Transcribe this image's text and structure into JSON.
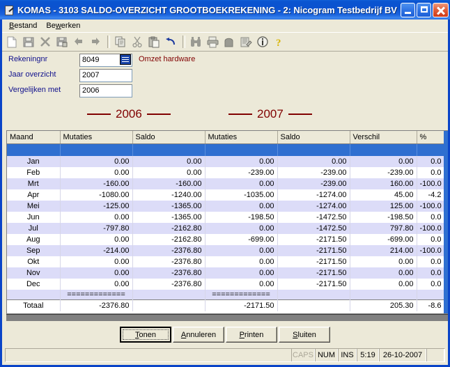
{
  "window": {
    "title": "KOMAS - 3103 SALDO-OVERZICHT GROOTBOEKREKENING - 2: Nicogram Testbedrijf BV",
    "icon": "document-pen-icon",
    "minimize_label": "",
    "maximize_label": "",
    "close_label": ""
  },
  "menu": {
    "items": [
      {
        "accel": "B",
        "rest": "estand"
      },
      {
        "accel": "B",
        "mid": "e",
        "accel2": "w",
        "rest": "erken"
      }
    ],
    "bestand": "Bestand",
    "bewerken": "Bewerken"
  },
  "toolbar": {
    "icons": [
      "new-document-icon",
      "save-icon",
      "delete-icon",
      "save-as-icon",
      "back-arrow-icon",
      "forward-arrow-icon",
      "copy-icon",
      "cut-icon",
      "paste-icon",
      "undo-icon",
      "find-binoculars-icon",
      "print-icon",
      "print-preview-icon",
      "edit-note-icon",
      "info-icon",
      "help-question-icon"
    ]
  },
  "form": {
    "rekeningnr_label": "Rekeningnr",
    "rekeningnr_value": "8049",
    "lookup_icon": "list-lookup-icon",
    "account_name": "Omzet hardware",
    "jaar_label": "Jaar overzicht",
    "jaar_value": "2007",
    "vergelijken_label": "Vergelijken met",
    "vergelijken_value": "2006"
  },
  "year_headers": {
    "left": "2006",
    "right": "2007"
  },
  "grid": {
    "columns": [
      "Maand",
      "Mutaties",
      "Saldo",
      "Mutaties",
      "Saldo",
      "Verschil",
      "%"
    ],
    "rows": [
      {
        "month": "Jan",
        "m1": "0.00",
        "s1": "0.00",
        "m2": "0.00",
        "s2": "0.00",
        "diff": "0.00",
        "pct": "0.0"
      },
      {
        "month": "Feb",
        "m1": "0.00",
        "s1": "0.00",
        "m2": "-239.00",
        "s2": "-239.00",
        "diff": "-239.00",
        "pct": "0.0"
      },
      {
        "month": "Mrt",
        "m1": "-160.00",
        "s1": "-160.00",
        "m2": "0.00",
        "s2": "-239.00",
        "diff": "160.00",
        "pct": "-100.0"
      },
      {
        "month": "Apr",
        "m1": "-1080.00",
        "s1": "-1240.00",
        "m2": "-1035.00",
        "s2": "-1274.00",
        "diff": "45.00",
        "pct": "-4.2"
      },
      {
        "month": "Mei",
        "m1": "-125.00",
        "s1": "-1365.00",
        "m2": "0.00",
        "s2": "-1274.00",
        "diff": "125.00",
        "pct": "-100.0"
      },
      {
        "month": "Jun",
        "m1": "0.00",
        "s1": "-1365.00",
        "m2": "-198.50",
        "s2": "-1472.50",
        "diff": "-198.50",
        "pct": "0.0"
      },
      {
        "month": "Jul",
        "m1": "-797.80",
        "s1": "-2162.80",
        "m2": "0.00",
        "s2": "-1472.50",
        "diff": "797.80",
        "pct": "-100.0"
      },
      {
        "month": "Aug",
        "m1": "0.00",
        "s1": "-2162.80",
        "m2": "-699.00",
        "s2": "-2171.50",
        "diff": "-699.00",
        "pct": "0.0"
      },
      {
        "month": "Sep",
        "m1": "-214.00",
        "s1": "-2376.80",
        "m2": "0.00",
        "s2": "-2171.50",
        "diff": "214.00",
        "pct": "-100.0"
      },
      {
        "month": "Okt",
        "m1": "0.00",
        "s1": "-2376.80",
        "m2": "0.00",
        "s2": "-2171.50",
        "diff": "0.00",
        "pct": "0.0"
      },
      {
        "month": "Nov",
        "m1": "0.00",
        "s1": "-2376.80",
        "m2": "0.00",
        "s2": "-2171.50",
        "diff": "0.00",
        "pct": "0.0"
      },
      {
        "month": "Dec",
        "m1": "0.00",
        "s1": "-2376.80",
        "m2": "0.00",
        "s2": "-2171.50",
        "diff": "0.00",
        "pct": "0.0"
      }
    ],
    "separator": "=============",
    "total": {
      "month": "Totaal",
      "m1": "-2376.80",
      "s1": "",
      "m2": "-2171.50",
      "s2": "",
      "diff": "205.30",
      "pct": "-8.6"
    }
  },
  "buttons": {
    "tonen": {
      "pre": "",
      "accel": "T",
      "post": "onen"
    },
    "annuleren": {
      "pre": "",
      "accel": "A",
      "post": "nnuleren"
    },
    "printen": {
      "pre": "",
      "accel": "P",
      "post": "rinten"
    },
    "sluiten": {
      "pre": "",
      "accel": "S",
      "post": "luiten"
    }
  },
  "status": {
    "caps": "CAPS",
    "num": "NUM",
    "ins": "INS",
    "time": "5:19",
    "date": "26-10-2007"
  },
  "colors": {
    "titlebar_blue": "#0b52cf",
    "client_beige": "#ece9d8",
    "label_navy": "#10108c",
    "accent_maroon": "#800000",
    "selection_blue": "#2f6fd0",
    "row_alt": "#dcdcf8"
  }
}
